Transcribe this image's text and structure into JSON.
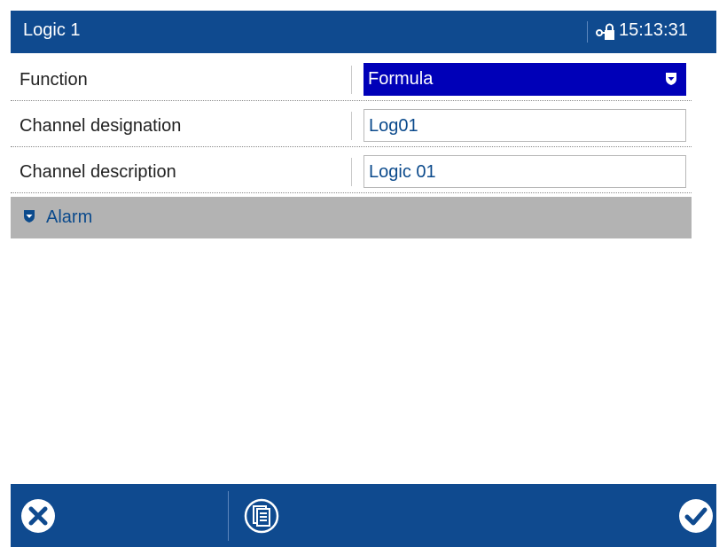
{
  "header": {
    "title": "Logic 1",
    "time": "15:13:31",
    "lock_icon": "lock-key-icon"
  },
  "rows": [
    {
      "label": "Function",
      "value": "Formula",
      "type": "select"
    },
    {
      "label": "Channel designation",
      "value": "Log01",
      "type": "text"
    },
    {
      "label": "Channel description",
      "value": "Logic 01",
      "type": "text"
    }
  ],
  "alarm_section": {
    "label": "Alarm",
    "icon": "expand-shield-icon"
  },
  "footer": {
    "cancel_icon": "cancel-x-icon",
    "docs_icon": "document-list-icon",
    "confirm_icon": "checkmark-icon"
  },
  "colors": {
    "header_bg": "#0f4a8f",
    "select_bg": "#0000b8",
    "section_bg": "#b3b3b3",
    "value_text": "#0b4a8c"
  }
}
